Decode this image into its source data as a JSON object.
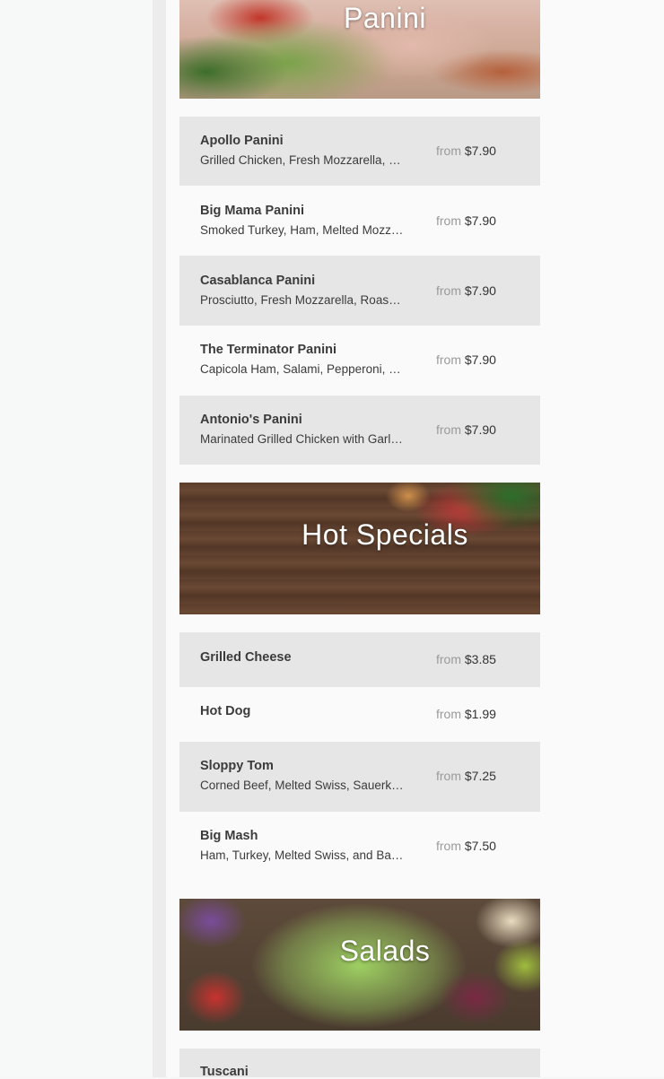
{
  "sections": [
    {
      "title": "Panini",
      "items": [
        {
          "name": "Apollo Panini",
          "desc": "Grilled Chicken, Fresh Mozzarella, …",
          "from": "from",
          "price": "$7.90"
        },
        {
          "name": "Big Mama Panini",
          "desc": "Smoked Turkey, Ham, Melted Mozz…",
          "from": "from",
          "price": "$7.90"
        },
        {
          "name": "Casablanca Panini",
          "desc": "Prosciutto, Fresh Mozzarella, Roas…",
          "from": "from",
          "price": "$7.90"
        },
        {
          "name": "The Terminator Panini",
          "desc": "Capicola Ham, Salami, Pepperoni, …",
          "from": "from",
          "price": "$7.90"
        },
        {
          "name": "Antonio's Panini",
          "desc": "Marinated Grilled Chicken with Garl…",
          "from": "from",
          "price": "$7.90"
        }
      ]
    },
    {
      "title": "Hot Specials",
      "items": [
        {
          "name": "Grilled Cheese",
          "desc": "",
          "from": "from",
          "price": "$3.85"
        },
        {
          "name": "Hot Dog",
          "desc": "",
          "from": "from",
          "price": "$1.99"
        },
        {
          "name": "Sloppy Tom",
          "desc": "Corned Beef, Melted Swiss, Sauerkr…",
          "from": "from",
          "price": "$7.25"
        },
        {
          "name": "Big Mash",
          "desc": "Ham, Turkey, Melted Swiss, and Ba…",
          "from": "from",
          "price": "$7.50"
        }
      ]
    },
    {
      "title": "Salads",
      "items": [
        {
          "name": "Tuscani",
          "desc": "",
          "from": "",
          "price": ""
        }
      ]
    }
  ]
}
